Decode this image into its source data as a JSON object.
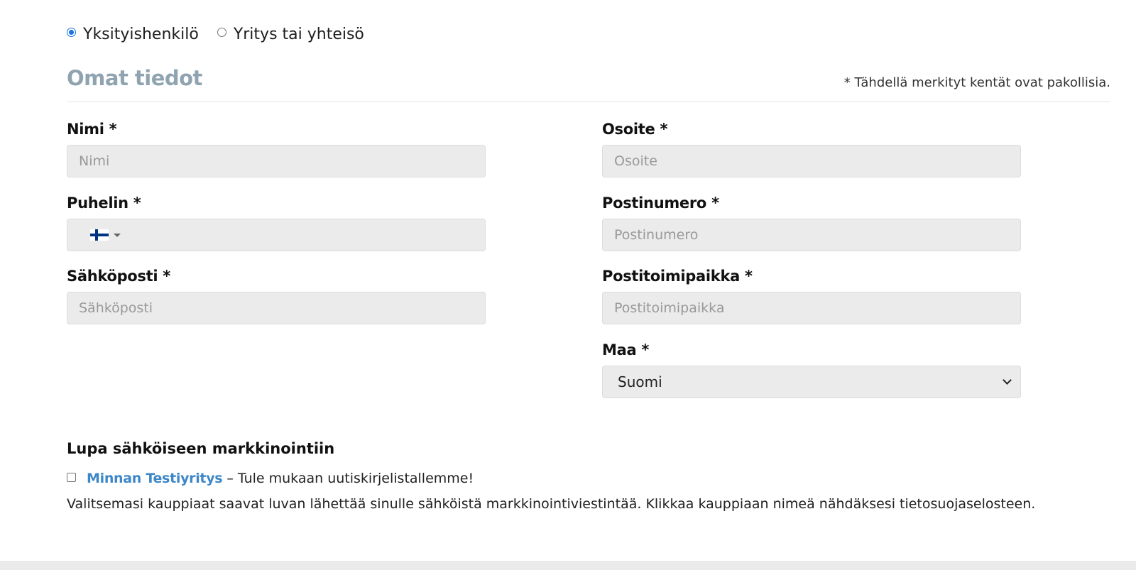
{
  "customer_type": {
    "options": [
      {
        "label": "Yksityishenkilö",
        "selected": true
      },
      {
        "label": "Yritys tai yhteisö",
        "selected": false
      }
    ]
  },
  "section": {
    "title": "Omat tiedot",
    "required_note": "* Tähdellä merkityt kentät ovat pakollisia."
  },
  "fields": {
    "name": {
      "label": "Nimi *",
      "placeholder": "Nimi",
      "value": ""
    },
    "phone": {
      "label": "Puhelin *",
      "country_flag": "finland-flag",
      "value": ""
    },
    "email": {
      "label": "Sähköposti *",
      "placeholder": "Sähköposti",
      "value": ""
    },
    "address": {
      "label": "Osoite *",
      "placeholder": "Osoite",
      "value": ""
    },
    "postal_code": {
      "label": "Postinumero *",
      "placeholder": "Postinumero",
      "value": ""
    },
    "city": {
      "label": "Postitoimipaikka *",
      "placeholder": "Postitoimipaikka",
      "value": ""
    },
    "country": {
      "label": "Maa *",
      "selected": "Suomi"
    }
  },
  "marketing": {
    "title": "Lupa sähköiseen markkinointiin",
    "merchant_name": "Minnan Testiyritys",
    "consent_text": "– Tule mukaan uutiskirjelistallemme!",
    "checked": false,
    "info": "Valitsemasi kauppiaat saavat luvan lähettää sinulle sähköistä markkinointiviestintää. Klikkaa kauppiaan nimeä nähdäksesi tietosuojaselosteen."
  },
  "colors": {
    "accent": "#1a73e8",
    "link": "#3d87c8",
    "section_title": "#8fa4b0",
    "input_background": "#ebebeb"
  }
}
